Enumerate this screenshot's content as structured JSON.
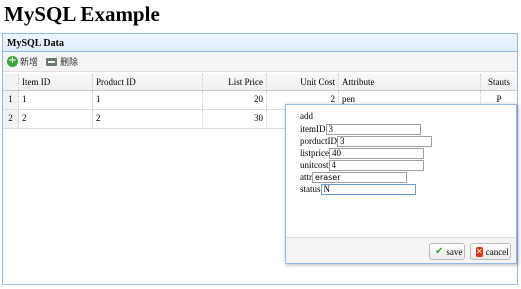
{
  "page": {
    "title": "MySQL Example"
  },
  "panel": {
    "title": "MySQL Data"
  },
  "toolbar": {
    "add_label": "新增",
    "delete_label": "删除",
    "add_icon": "add-icon",
    "delete_icon": "delete-icon"
  },
  "grid": {
    "columns": [
      "Item ID",
      "Product ID",
      "List Price",
      "Unit Cost",
      "Attribute",
      "Stauts"
    ],
    "rows": [
      {
        "num": "1",
        "item_id": "1",
        "product_id": "1",
        "list_price": "20",
        "unit_cost": "2",
        "attribute": "pen",
        "status": "P"
      },
      {
        "num": "2",
        "item_id": "2",
        "product_id": "2",
        "list_price": "30",
        "unit_cost": "",
        "attribute": "",
        "status": ""
      }
    ]
  },
  "dialog": {
    "title": "add",
    "fields": {
      "item_id": {
        "label": "itemID",
        "value": "3"
      },
      "product_id": {
        "label": "porductID",
        "value": "3"
      },
      "list_price": {
        "label": "listprice",
        "value": "40"
      },
      "unit_cost": {
        "label": "unitcost",
        "value": "4"
      },
      "attr": {
        "label": "attr",
        "value": "eraser"
      },
      "status": {
        "label": "status",
        "value": "N"
      }
    },
    "save_label": "save",
    "cancel_label": "cancel"
  },
  "colors": {
    "panel_border": "#95b8e7",
    "save_icon": "#3aa53a",
    "cancel_icon": "#d9361c"
  }
}
